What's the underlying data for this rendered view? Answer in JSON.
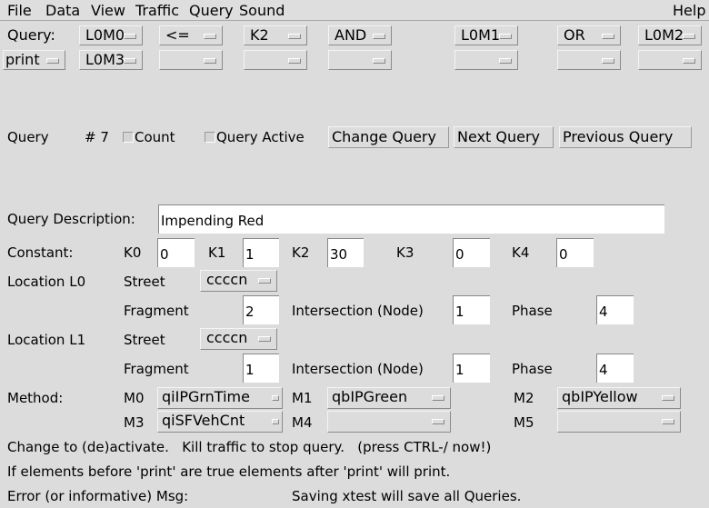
{
  "menu": {
    "file": "File",
    "data": "Data",
    "view": "View",
    "traffic": "Traffic",
    "query": "Query",
    "sound": "Sound",
    "help": "Help"
  },
  "query_row": {
    "label": "Query:",
    "row1": [
      "L0M0",
      "<=",
      "K2",
      "AND",
      "L0M1",
      "OR",
      "L0M2"
    ],
    "row2": [
      "print",
      "L0M3",
      "",
      "",
      "",
      "",
      "",
      ""
    ]
  },
  "controls": {
    "query_label": "Query",
    "number": "# 7",
    "count_label": "Count",
    "count_checked": false,
    "active_label": "Query Active",
    "active_checked": false,
    "change": "Change Query",
    "next": "Next Query",
    "previous": "Previous Query"
  },
  "description": {
    "label": "Query Description:",
    "value": "Impending Red"
  },
  "constants": {
    "label": "Constant:",
    "k0_label": "K0",
    "k0": "0",
    "k1_label": "K1",
    "k1": "1",
    "k2_label": "K2",
    "k2": "30",
    "k3_label": "K3",
    "k3": "0",
    "k4_label": "K4",
    "k4": "0"
  },
  "locations": [
    {
      "label": "Location L0",
      "street_label": "Street",
      "street": "ccccn",
      "fragment_label": "Fragment",
      "fragment": "2",
      "node_label": "Intersection (Node)",
      "node": "1",
      "phase_label": "Phase",
      "phase": "4"
    },
    {
      "label": "Location L1",
      "street_label": "Street",
      "street": "ccccn",
      "fragment_label": "Fragment",
      "fragment": "1",
      "node_label": "Intersection (Node)",
      "node": "1",
      "phase_label": "Phase",
      "phase": "4"
    }
  ],
  "method": {
    "label": "Method:",
    "m0_label": "M0",
    "m0": "qiIPGrnTime",
    "m1_label": "M1",
    "m1": "qbIPGreen",
    "m2_label": "M2",
    "m2": "qbIPYellow",
    "m3_label": "M3",
    "m3": "qiSFVehCnt",
    "m4_label": "M4",
    "m4": "",
    "m5_label": "M5",
    "m5": ""
  },
  "messages": {
    "line1": "Change to (de)activate.   Kill traffic to stop query.   (press CTRL-/ now!)",
    "line2": "If elements before 'print' are true elements after 'print' will print.",
    "error_label": "Error (or informative) Msg:",
    "error": "Saving xtest will save all Queries."
  }
}
